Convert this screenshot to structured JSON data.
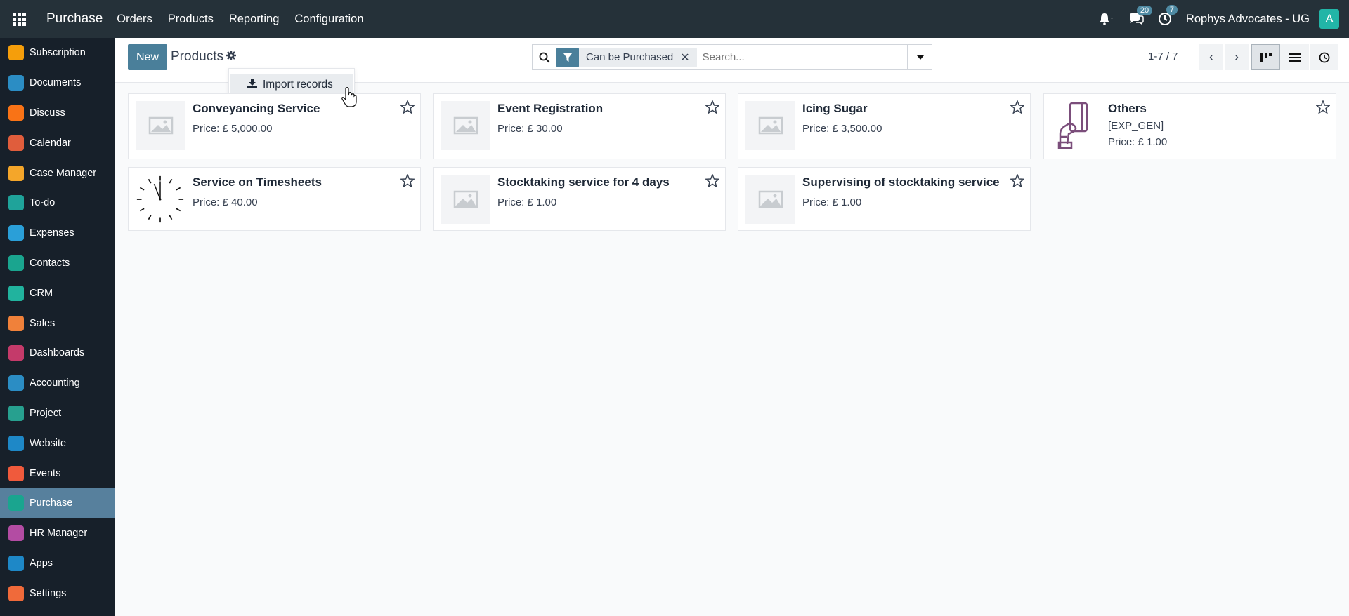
{
  "navbar": {
    "app_name": "Purchase",
    "menu": [
      "Orders",
      "Products",
      "Reporting",
      "Configuration"
    ],
    "messages_count": "20",
    "activities_count": "7",
    "company": "Rophys Advocates - UG",
    "avatar_letter": "A"
  },
  "sidebar": {
    "items": [
      {
        "label": "Subscription",
        "icon": "subscription-icon",
        "color": "#f59e0b"
      },
      {
        "label": "Documents",
        "icon": "documents-icon",
        "color": "#2b8dc4"
      },
      {
        "label": "Discuss",
        "icon": "discuss-icon",
        "color": "#f97316"
      },
      {
        "label": "Calendar",
        "icon": "calendar-icon",
        "color": "#e05d3c"
      },
      {
        "label": "Case Manager",
        "icon": "case-manager-icon",
        "color": "#f4a62a"
      },
      {
        "label": "To-do",
        "icon": "todo-icon",
        "color": "#1fa39a"
      },
      {
        "label": "Expenses",
        "icon": "expenses-icon",
        "color": "#2a9fd8"
      },
      {
        "label": "Contacts",
        "icon": "contacts-icon",
        "color": "#1aa58f"
      },
      {
        "label": "CRM",
        "icon": "crm-icon",
        "color": "#21b39e"
      },
      {
        "label": "Sales",
        "icon": "sales-icon",
        "color": "#f0813a"
      },
      {
        "label": "Dashboards",
        "icon": "dashboards-icon",
        "color": "#c43a6a"
      },
      {
        "label": "Accounting",
        "icon": "accounting-icon",
        "color": "#2b8dc4"
      },
      {
        "label": "Project",
        "icon": "project-icon",
        "color": "#27a08f"
      },
      {
        "label": "Website",
        "icon": "website-icon",
        "color": "#1e88c7"
      },
      {
        "label": "Events",
        "icon": "events-icon",
        "color": "#f05a3c"
      },
      {
        "label": "Purchase",
        "icon": "purchase-icon",
        "color": "#1aa58f",
        "active": true
      },
      {
        "label": "HR Manager",
        "icon": "hr-manager-icon",
        "color": "#b34ca3"
      },
      {
        "label": "Apps",
        "icon": "apps-icon",
        "color": "#1e88c7"
      },
      {
        "label": "Settings",
        "icon": "settings-icon",
        "color": "#f06a3a"
      }
    ]
  },
  "control_panel": {
    "new_label": "New",
    "title": "Products",
    "facet_label": "Can be Purchased",
    "search_placeholder": "Search...",
    "pager": "1-7 / 7"
  },
  "dropdown": {
    "import_label": "Import records"
  },
  "products": [
    {
      "name": "Conveyancing Service",
      "price": "Price: £ 5,000.00",
      "image": "placeholder-image-icon"
    },
    {
      "name": "Event Registration",
      "price": "Price: £ 30.00",
      "image": "placeholder-image-icon"
    },
    {
      "name": "Icing Sugar",
      "price": "Price: £ 3,500.00",
      "image": "placeholder-image-icon"
    },
    {
      "name": "Others",
      "code": "[EXP_GEN]",
      "price": "Price: £ 1.00",
      "image": "hand-card-icon"
    },
    {
      "name": "Service on Timesheets",
      "price": "Price: £ 40.00",
      "image": "clock-icon"
    },
    {
      "name": "Stocktaking service for 4 days",
      "price": "Price: £ 1.00",
      "image": "placeholder-image-icon"
    },
    {
      "name": "Supervising of stocktaking service",
      "price": "Price: £ 1.00",
      "image": "placeholder-image-icon"
    }
  ]
}
